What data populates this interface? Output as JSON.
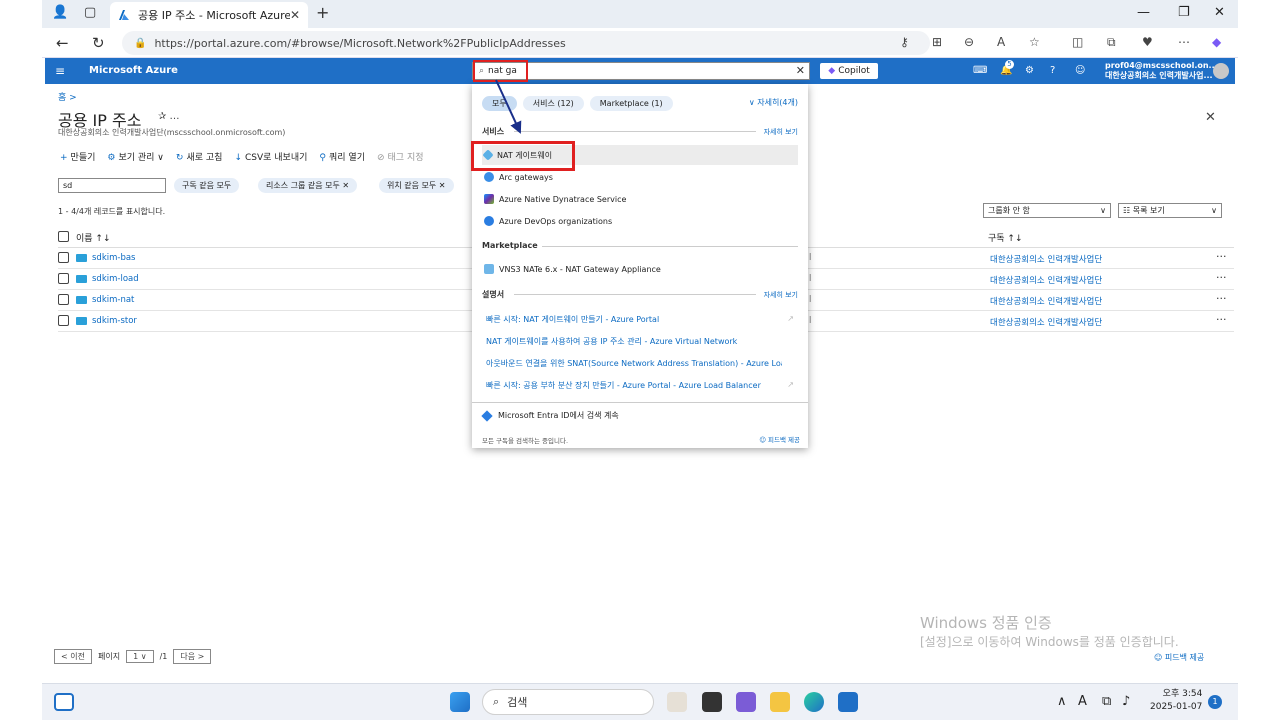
{
  "browser": {
    "tab_title": "공용 IP 주소 - Microsoft Azure",
    "url": "https://portal.azure.com/#browse/Microsoft.Network%2FPublicIpAddresses"
  },
  "azure": {
    "brand": "Microsoft Azure",
    "search_value": "nat ga",
    "copilot": "Copilot",
    "notification_count": "5",
    "account_name": "prof04@mscsschool.on...",
    "account_org": "대한상공회의소 인력개발사업..."
  },
  "page": {
    "breadcrumb": "홈 >",
    "title": "공용 IP 주소",
    "title_icons": "✰  …",
    "subtitle": "대한상공회의소 인력개발사업단(mscsschool.onmicrosoft.com)",
    "toolbar": [
      {
        "icon": "+",
        "label": "만들기"
      },
      {
        "icon": "⚙",
        "label": "보기 관리 ∨"
      },
      {
        "icon": "↻",
        "label": "새로 고침"
      },
      {
        "icon": "↓",
        "label": "CSV로 내보내기"
      },
      {
        "icon": "⚲",
        "label": "쿼리 열기"
      },
      {
        "icon": "⊘",
        "label": "태그 지정"
      }
    ],
    "filter_value": "sd",
    "pills": [
      "구독 같음 모두",
      "리소스 그룹 같음 모두 ✕",
      "위치 같음 모두 ✕"
    ],
    "count_text": "1 - 4/4개 레코드를 표시합니다.",
    "group_by": "그룹화 안 함",
    "view": "☷ 목록 보기",
    "col_name": "이름 ↑↓",
    "col_sub": "구독 ↑↓",
    "rows": [
      {
        "name": "sdkim-bas",
        "mid": "l",
        "sub": "대한상공회의소 인력개발사업단"
      },
      {
        "name": "sdkim-load",
        "mid": "l",
        "sub": "대한상공회의소 인력개발사업단"
      },
      {
        "name": "sdkim-nat",
        "mid": "l",
        "sub": "대한상공회의소 인력개발사업단"
      },
      {
        "name": "sdkim-stor",
        "mid": "l",
        "sub": "대한상공회의소 인력개발사업단"
      }
    ],
    "pager": {
      "prev": "< 이전",
      "page_label": "페이지",
      "page": "1",
      "of": "/1",
      "next": "다음 >"
    },
    "watermark_title": "Windows 정품 인증",
    "watermark_text": "[설정]으로 이동하여 Windows를 정품 인증합니다.",
    "feedback": "피드백 제공"
  },
  "dropdown": {
    "tabs": [
      {
        "label": "모두",
        "active": true
      },
      {
        "label": "서비스 (12)",
        "active": false
      },
      {
        "label": "Marketplace (1)",
        "active": false
      }
    ],
    "more": "∨ 자세히(4개)",
    "services_header": "서비스",
    "services_link": "자세히 보기",
    "services": [
      "NAT 게이트웨이",
      "Arc gateways",
      "Azure Native Dynatrace Service",
      "Azure DevOps organizations"
    ],
    "marketplace_header": "Marketplace",
    "marketplace": [
      "VNS3 NATe 6.x - NAT Gateway Appliance"
    ],
    "docs_header": "설명서",
    "docs_link": "자세히 보기",
    "docs": [
      "빠른 시작: NAT 게이트웨이 만들기 - Azure Portal",
      "NAT 게이트웨이를 사용하여 공용 IP 주소 관리 - Azure Virtual Network",
      "아웃바운드 연결을 위한 SNAT(Source Network Address Translation) - Azure Loa...",
      "빠른 시작: 공용 부하 분산 장치 만들기 - Azure Portal - Azure Load Balancer"
    ],
    "entra": "Microsoft Entra ID에서 검색 계속",
    "status": "모든 구독을 검색하는 중입니다.",
    "feedback": "피드백 제공"
  },
  "taskbar": {
    "search": "검색",
    "time": "오후 3:54",
    "date": "2025-01-07",
    "notif": "1"
  }
}
